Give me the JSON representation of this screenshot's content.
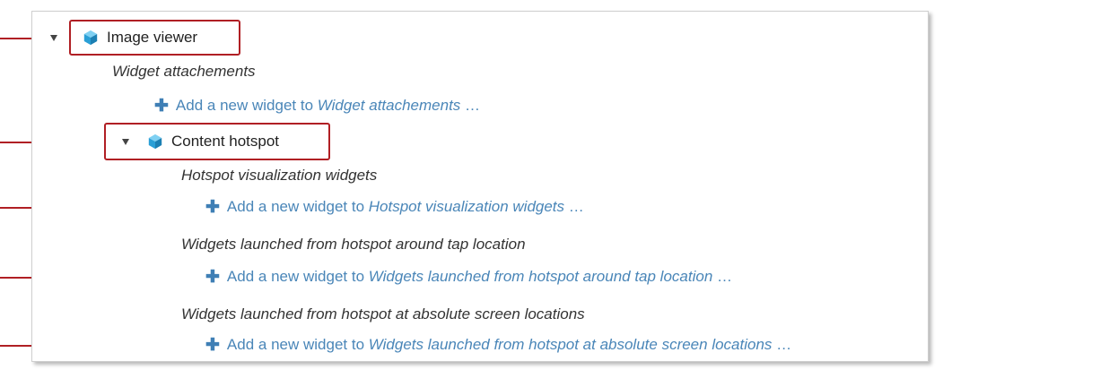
{
  "tree": {
    "image_viewer": {
      "label": "Image viewer",
      "icon": "cube-icon",
      "section": "Widget attachements",
      "add": {
        "prefix": "Add a new widget to ",
        "target": "Widget attachements",
        "suffix": " …"
      }
    },
    "content_hotspot": {
      "label": "Content hotspot",
      "icon": "cube-icon",
      "sections": [
        {
          "label": "Hotspot visualization widgets",
          "add": {
            "prefix": "Add a new widget to ",
            "target": "Hotspot visualization widgets",
            "suffix": " …"
          }
        },
        {
          "label": "Widgets launched from hotspot around tap location",
          "add": {
            "prefix": "Add a new widget to ",
            "target": "Widgets launched from hotspot around tap location",
            "suffix": " …"
          }
        },
        {
          "label": "Widgets launched from hotspot at absolute screen locations",
          "add": {
            "prefix": "Add a new widget to ",
            "target": "Widgets launched from hotspot at absolute screen locations",
            "suffix": " …"
          }
        }
      ]
    }
  },
  "colors": {
    "callout": "#b01f24",
    "link": "#4a86b8",
    "cube_icon": "#2a9fd6"
  }
}
